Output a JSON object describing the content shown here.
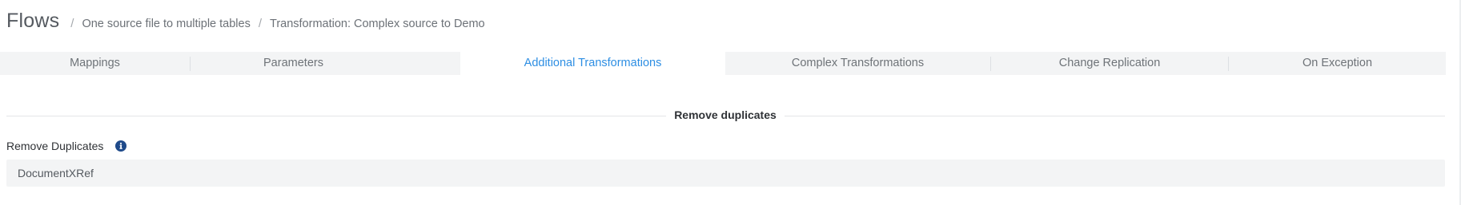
{
  "header": {
    "title": "Flows",
    "separator": "/",
    "breadcrumbs": [
      "One source file to multiple tables",
      "Transformation: Complex source to Demo"
    ]
  },
  "tabs": [
    {
      "label": "Mappings",
      "active": false
    },
    {
      "label": "Parameters",
      "active": false
    },
    {
      "label": "Additional Transformations",
      "active": true
    },
    {
      "label": "Complex Transformations",
      "active": false
    },
    {
      "label": "Change Replication",
      "active": false
    },
    {
      "label": "On Exception",
      "active": false
    }
  ],
  "section": {
    "title": "Remove duplicates"
  },
  "field": {
    "label": "Remove Duplicates",
    "value": "DocumentXRef",
    "info_icon": "info-circle-icon"
  },
  "colors": {
    "accent": "#2d8ee3",
    "info_icon": "#1f4a8a",
    "tab_bar_bg": "#f3f4f5"
  }
}
